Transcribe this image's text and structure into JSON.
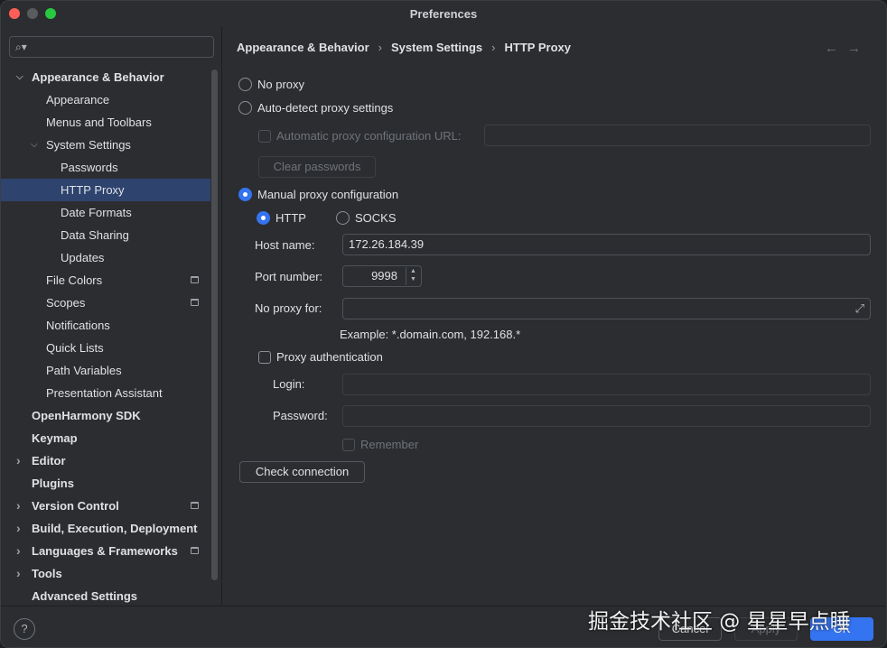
{
  "window": {
    "title": "Preferences"
  },
  "search": {
    "placeholder": ""
  },
  "sidebar": {
    "items": [
      {
        "label": "Appearance & Behavior",
        "level": 0,
        "bold": true,
        "expanded": true
      },
      {
        "label": "Appearance",
        "level": 1
      },
      {
        "label": "Menus and Toolbars",
        "level": 1
      },
      {
        "label": "System Settings",
        "level": 1,
        "expanded": true
      },
      {
        "label": "Passwords",
        "level": 2
      },
      {
        "label": "HTTP Proxy",
        "level": 2,
        "selected": true
      },
      {
        "label": "Date Formats",
        "level": 2
      },
      {
        "label": "Data Sharing",
        "level": 2
      },
      {
        "label": "Updates",
        "level": 2
      },
      {
        "label": "File Colors",
        "level": 1,
        "badge": true
      },
      {
        "label": "Scopes",
        "level": 1,
        "badge": true
      },
      {
        "label": "Notifications",
        "level": 1
      },
      {
        "label": "Quick Lists",
        "level": 1
      },
      {
        "label": "Path Variables",
        "level": 1
      },
      {
        "label": "Presentation Assistant",
        "level": 1
      },
      {
        "label": "OpenHarmony SDK",
        "level": 0,
        "bold": true
      },
      {
        "label": "Keymap",
        "level": 0,
        "bold": true
      },
      {
        "label": "Editor",
        "level": 0,
        "bold": true,
        "collapsed": true
      },
      {
        "label": "Plugins",
        "level": 0,
        "bold": true
      },
      {
        "label": "Version Control",
        "level": 0,
        "bold": true,
        "collapsed": true,
        "badge": true
      },
      {
        "label": "Build, Execution, Deployment",
        "level": 0,
        "bold": true,
        "collapsed": true
      },
      {
        "label": "Languages & Frameworks",
        "level": 0,
        "bold": true,
        "collapsed": true,
        "badge": true
      },
      {
        "label": "Tools",
        "level": 0,
        "bold": true,
        "collapsed": true
      },
      {
        "label": "Advanced Settings",
        "level": 0,
        "bold": true
      }
    ]
  },
  "breadcrumb": {
    "items": [
      "Appearance & Behavior",
      "System Settings",
      "HTTP Proxy"
    ],
    "separator": "›"
  },
  "nav": {
    "back": "←",
    "forward": "→"
  },
  "proxy": {
    "no_proxy": "No proxy",
    "auto_detect": "Auto-detect proxy settings",
    "auto_config_url_label": "Automatic proxy configuration URL:",
    "auto_config_url_value": "",
    "clear_passwords": "Clear passwords",
    "manual": "Manual proxy configuration",
    "selected_mode": "manual",
    "http": "HTTP",
    "socks": "SOCKS",
    "selected_protocol": "HTTP",
    "host_label": "Host name:",
    "host_value": "172.26.184.39",
    "port_label": "Port number:",
    "port_value": "9998",
    "no_proxy_for_label": "No proxy for:",
    "no_proxy_for_value": "",
    "example": "Example: *.domain.com, 192.168.*",
    "auth_label": "Proxy authentication",
    "login_label": "Login:",
    "login_value": "",
    "password_label": "Password:",
    "password_value": "",
    "remember": "Remember",
    "check_connection": "Check connection"
  },
  "footer": {
    "help": "?",
    "cancel": "Cancel",
    "apply": "Apply",
    "ok": "OK"
  },
  "watermark": "掘金技术社区 @ 星星早点睡",
  "colors": {
    "accent": "#3574f0",
    "selection": "#2e436e",
    "background": "#2b2d30"
  }
}
